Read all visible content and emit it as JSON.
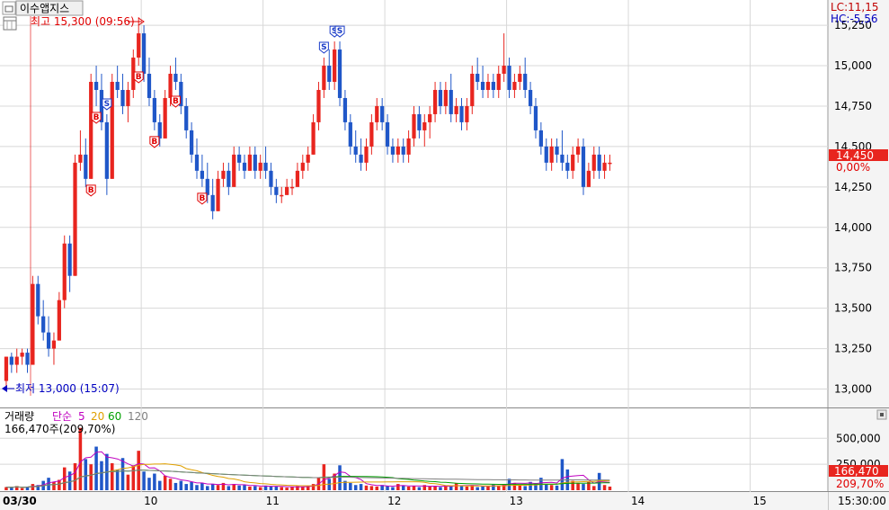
{
  "stock_name": "이수앱지스",
  "lc_label": "LC:11,15",
  "hc_label": "HC:-5,56",
  "high_marker": "최고 15,300 (09:56)",
  "low_marker": "최저 13,000 (15:07)",
  "current_price_label": "14,450",
  "current_pct_label": "0,00%",
  "volume_legend": {
    "prefix": "거래량",
    "ma_kind": "단순",
    "ma_periods": [
      "5",
      "20",
      "60",
      "120"
    ],
    "ma_colors": [
      "#c000c0",
      "#e0a000",
      "#00a000",
      "#808080"
    ],
    "summary": "166,470주(209,70%)"
  },
  "volume_current_label": "166,470",
  "volume_pct_label": "209,70%",
  "time_label": "15:30:00",
  "colors": {
    "up": "#e8251f",
    "down": "#2057c8",
    "axis_bg": "#f4f4f4",
    "grid": "#d8d8d8",
    "separator": "#8a8a8a",
    "high_text": "#e00000",
    "low_text": "#0000c0"
  },
  "chart_data": [
    {
      "type": "candlestick",
      "ylim": [
        12925,
        15295
      ],
      "y_ticks": [
        "13,000",
        "13,250",
        "13,500",
        "13,750",
        "14,000",
        "14,250",
        "14,500",
        "14,750",
        "15,000",
        "15,250"
      ],
      "x_labels": [
        "03/30",
        "10",
        "11",
        "12",
        "13",
        "14",
        "15"
      ],
      "x_label_index": [
        0,
        26,
        49,
        72,
        95,
        118,
        141
      ],
      "x_separator_index": [
        26,
        49,
        72,
        95,
        118,
        141
      ],
      "n_points": 155,
      "candles": [
        [
          13050,
          13200,
          13000,
          13200
        ],
        [
          13200,
          13225,
          13100,
          13150
        ],
        [
          13150,
          13250,
          13100,
          13200
        ],
        [
          13200,
          13250,
          13150,
          13225
        ],
        [
          13225,
          13250,
          13100,
          13150
        ],
        [
          13150,
          13700,
          13150,
          13650
        ],
        [
          13650,
          13700,
          13400,
          13450
        ],
        [
          13450,
          13550,
          13300,
          13350
        ],
        [
          13350,
          13450,
          13200,
          13250
        ],
        [
          13250,
          13350,
          13150,
          13300
        ],
        [
          13300,
          13600,
          13300,
          13550
        ],
        [
          13550,
          13950,
          13500,
          13900
        ],
        [
          13900,
          13950,
          13600,
          13700
        ],
        [
          13700,
          14450,
          13700,
          14400
        ],
        [
          14400,
          14600,
          14350,
          14450
        ],
        [
          14450,
          14550,
          14250,
          14300
        ],
        [
          14300,
          14950,
          14300,
          14900
        ],
        [
          14900,
          15000,
          14750,
          14850
        ],
        [
          14850,
          14950,
          14600,
          14650
        ],
        [
          14650,
          14700,
          14200,
          14300
        ],
        [
          14300,
          14950,
          14300,
          14900
        ],
        [
          14900,
          15000,
          14800,
          14850
        ],
        [
          14850,
          14950,
          14700,
          14750
        ],
        [
          14750,
          14900,
          14650,
          14850
        ],
        [
          14850,
          15100,
          14800,
          15050
        ],
        [
          15050,
          15300,
          15000,
          15200
        ],
        [
          15200,
          15250,
          14900,
          14950
        ],
        [
          14950,
          15050,
          14750,
          14800
        ],
        [
          14800,
          14850,
          14600,
          14650
        ],
        [
          14650,
          14700,
          14500,
          14550
        ],
        [
          14550,
          14850,
          14550,
          14800
        ],
        [
          14800,
          15000,
          14750,
          14950
        ],
        [
          14950,
          15050,
          14850,
          14900
        ],
        [
          14900,
          14950,
          14700,
          14750
        ],
        [
          14750,
          14800,
          14550,
          14600
        ],
        [
          14600,
          14650,
          14400,
          14450
        ],
        [
          14450,
          14550,
          14300,
          14350
        ],
        [
          14350,
          14450,
          14250,
          14300
        ],
        [
          14300,
          14400,
          14150,
          14200
        ],
        [
          14200,
          14300,
          14050,
          14100
        ],
        [
          14100,
          14350,
          14100,
          14300
        ],
        [
          14300,
          14400,
          14250,
          14350
        ],
        [
          14350,
          14400,
          14200,
          14250
        ],
        [
          14250,
          14500,
          14250,
          14450
        ],
        [
          14450,
          14500,
          14350,
          14400
        ],
        [
          14400,
          14450,
          14300,
          14350
        ],
        [
          14350,
          14500,
          14350,
          14450
        ],
        [
          14450,
          14500,
          14300,
          14350
        ],
        [
          14350,
          14450,
          14300,
          14400
        ],
        [
          14400,
          14500,
          14300,
          14350
        ],
        [
          14350,
          14400,
          14200,
          14250
        ],
        [
          14250,
          14300,
          14150,
          14200
        ],
        [
          14200,
          14250,
          14150,
          14200
        ],
        [
          14200,
          14300,
          14200,
          14250
        ],
        [
          14250,
          14300,
          14200,
          14250
        ],
        [
          14250,
          14400,
          14250,
          14350
        ],
        [
          14350,
          14450,
          14300,
          14400
        ],
        [
          14400,
          14500,
          14350,
          14450
        ],
        [
          14450,
          14700,
          14450,
          14650
        ],
        [
          14650,
          14900,
          14600,
          14850
        ],
        [
          14850,
          15050,
          14800,
          15000
        ],
        [
          15000,
          15100,
          14850,
          14900
        ],
        [
          14900,
          15150,
          14850,
          15100
        ],
        [
          15100,
          15150,
          14750,
          14800
        ],
        [
          14800,
          14850,
          14600,
          14650
        ],
        [
          14650,
          14700,
          14450,
          14500
        ],
        [
          14500,
          14600,
          14400,
          14450
        ],
        [
          14450,
          14550,
          14350,
          14400
        ],
        [
          14400,
          14550,
          14350,
          14500
        ],
        [
          14500,
          14700,
          14450,
          14650
        ],
        [
          14650,
          14800,
          14600,
          14750
        ],
        [
          14750,
          14800,
          14600,
          14650
        ],
        [
          14650,
          14700,
          14450,
          14500
        ],
        [
          14500,
          14550,
          14400,
          14450
        ],
        [
          14450,
          14550,
          14400,
          14500
        ],
        [
          14500,
          14550,
          14400,
          14450
        ],
        [
          14450,
          14600,
          14400,
          14550
        ],
        [
          14550,
          14750,
          14500,
          14700
        ],
        [
          14700,
          14750,
          14550,
          14600
        ],
        [
          14600,
          14700,
          14500,
          14650
        ],
        [
          14650,
          14750,
          14550,
          14700
        ],
        [
          14700,
          14900,
          14650,
          14850
        ],
        [
          14850,
          14900,
          14700,
          14750
        ],
        [
          14750,
          14900,
          14700,
          14850
        ],
        [
          14850,
          14950,
          14650,
          14700
        ],
        [
          14700,
          14800,
          14650,
          14750
        ],
        [
          14750,
          14800,
          14600,
          14650
        ],
        [
          14650,
          14800,
          14600,
          14750
        ],
        [
          14750,
          15000,
          14700,
          14950
        ],
        [
          14950,
          15050,
          14850,
          14900
        ],
        [
          14900,
          15000,
          14800,
          14850
        ],
        [
          14850,
          14950,
          14800,
          14900
        ],
        [
          14900,
          14950,
          14800,
          14850
        ],
        [
          14850,
          15000,
          14800,
          14950
        ],
        [
          14950,
          15200,
          14900,
          15000
        ],
        [
          15000,
          15050,
          14800,
          14850
        ],
        [
          14850,
          14950,
          14800,
          14900
        ],
        [
          14900,
          15000,
          14850,
          14950
        ],
        [
          14950,
          15050,
          14800,
          14850
        ],
        [
          14850,
          14900,
          14700,
          14750
        ],
        [
          14750,
          14800,
          14550,
          14600
        ],
        [
          14600,
          14650,
          14450,
          14500
        ],
        [
          14500,
          14550,
          14350,
          14400
        ],
        [
          14400,
          14550,
          14350,
          14500
        ],
        [
          14500,
          14550,
          14400,
          14450
        ],
        [
          14450,
          14600,
          14350,
          14400
        ],
        [
          14400,
          14450,
          14300,
          14350
        ],
        [
          14350,
          14500,
          14300,
          14450
        ],
        [
          14450,
          14550,
          14400,
          14500
        ],
        [
          14500,
          14550,
          14200,
          14250
        ],
        [
          14250,
          14400,
          14250,
          14350
        ],
        [
          14350,
          14500,
          14300,
          14450
        ],
        [
          14450,
          14500,
          14300,
          14350
        ],
        [
          14350,
          14450,
          14300,
          14400
        ],
        [
          14400,
          14450,
          14350,
          14400
        ]
      ],
      "buy_markers_index": [
        16,
        17,
        25,
        28,
        32,
        37
      ],
      "sell_markers_index": [
        19,
        60,
        62,
        63
      ],
      "high_index": 25,
      "low_index": 7
    },
    {
      "type": "bar",
      "series_name": "거래량",
      "ylim": [
        0,
        650000
      ],
      "y_ticks": [
        "250,000",
        "500,000"
      ],
      "values": [
        30000,
        25000,
        40000,
        20000,
        35000,
        60000,
        50000,
        90000,
        120000,
        80000,
        100000,
        220000,
        180000,
        260000,
        600000,
        300000,
        250000,
        420000,
        280000,
        350000,
        260000,
        200000,
        310000,
        150000,
        240000,
        380000,
        180000,
        120000,
        160000,
        90000,
        140000,
        110000,
        70000,
        90000,
        60000,
        80000,
        50000,
        70000,
        40000,
        60000,
        50000,
        70000,
        40000,
        60000,
        45000,
        50000,
        35000,
        40000,
        30000,
        45000,
        40000,
        35000,
        30000,
        25000,
        35000,
        40000,
        30000,
        45000,
        60000,
        120000,
        250000,
        110000,
        160000,
        240000,
        90000,
        70000,
        50000,
        60000,
        45000,
        40000,
        35000,
        50000,
        40000,
        30000,
        60000,
        45000,
        35000,
        40000,
        30000,
        50000,
        35000,
        40000,
        30000,
        45000,
        35000,
        70000,
        40000,
        35000,
        50000,
        30000,
        40000,
        35000,
        55000,
        45000,
        60000,
        110000,
        70000,
        50000,
        40000,
        80000,
        70000,
        120000,
        60000,
        50000,
        45000,
        300000,
        200000,
        90000,
        70000,
        60000,
        80000,
        40000,
        166470,
        50000,
        35000
      ]
    }
  ]
}
